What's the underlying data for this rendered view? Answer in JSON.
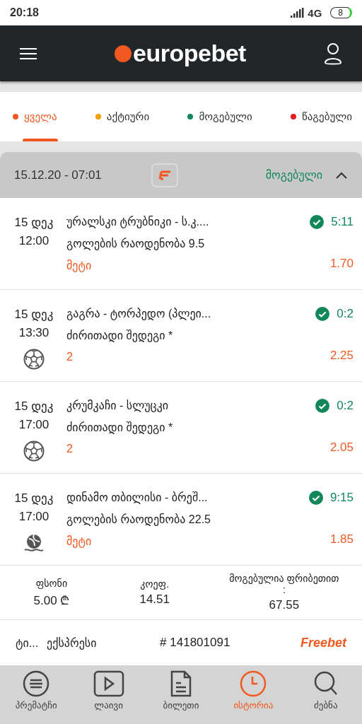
{
  "status_bar": {
    "time": "20:18",
    "network": "4G",
    "battery": "8"
  },
  "header": {
    "logo": "europebet"
  },
  "filter_tabs": [
    {
      "label": "ყველა",
      "color": "#f05a22",
      "selected": true
    },
    {
      "label": "აქტიური",
      "color": "#f5a000",
      "selected": false
    },
    {
      "label": "მოგებული",
      "color": "#11875a",
      "selected": false
    },
    {
      "label": "წაგებული",
      "color": "#e41b23",
      "selected": false
    }
  ],
  "ticket": {
    "date": "15.12.20 - 07:01",
    "status": "მოგებული",
    "expanded": true,
    "bets": [
      {
        "date": "15 დეკ",
        "time": "12:00",
        "match": "ურალსკი ტრუბნიკი - ს.კ....",
        "market": "გოლების რაოდენობა 9.5",
        "pick": "მეტი",
        "won": true,
        "score": "5:11",
        "odds": "1.70",
        "kind": "plain"
      },
      {
        "date": "15 დეკ",
        "time": "13:30",
        "match": "გაგრა - ტორპედო (პლეი...",
        "market": "ძირითადი შედეგი *",
        "pick": "2",
        "won": true,
        "score": "0:2",
        "odds": "2.25",
        "kind": "football"
      },
      {
        "date": "15 დეკ",
        "time": "17:00",
        "match": "კრუმკაჩი - სლუცკი",
        "market": "ძირითადი შედეგი *",
        "pick": "2",
        "won": true,
        "score": "0:2",
        "odds": "2.05",
        "kind": "football"
      },
      {
        "date": "15 დეკ",
        "time": "17:00",
        "match": "დინამო თბილისი - ბრეშ...",
        "market": "გოლების რაოდენობა 22.5",
        "pick": "მეტი",
        "won": true,
        "score": "9:15",
        "odds": "1.85",
        "kind": "waterpolo"
      }
    ],
    "summary": [
      {
        "label": "ფსონი",
        "value": "5.00 ₾"
      },
      {
        "label": "კოეფ.",
        "value": "14.51"
      },
      {
        "label": "მოგებულია ფრიბეთით :",
        "value": "67.55"
      }
    ],
    "type_short": "ტი...",
    "type": "ექსპრესი",
    "number": "# 141801091",
    "badge": "Freebet"
  },
  "bottom_nav": [
    {
      "label": "პრემატჩი",
      "selected": false
    },
    {
      "label": "ლაივი",
      "selected": false
    },
    {
      "label": "ბილეთი",
      "selected": false
    },
    {
      "label": "ისტორია",
      "selected": true
    },
    {
      "label": "ძებნა",
      "selected": false
    }
  ]
}
